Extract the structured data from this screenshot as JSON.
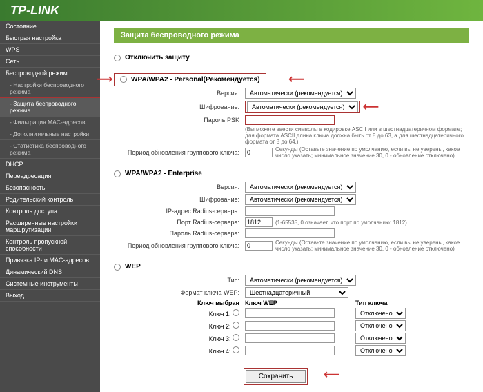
{
  "logo": "TP-LINK",
  "sidebar": {
    "items": [
      {
        "label": "Состояние"
      },
      {
        "label": "Быстрая настройка"
      },
      {
        "label": "WPS"
      },
      {
        "label": "Сеть"
      },
      {
        "label": "Беспроводной режим"
      },
      {
        "label": "- Настройки беспроводного режима",
        "sub": true
      },
      {
        "label": "- Защита беспроводного режима",
        "sub": true,
        "active": true
      },
      {
        "label": "- Фильтрация MAC-адресов",
        "sub": true
      },
      {
        "label": "- Дополнительные настройки",
        "sub": true
      },
      {
        "label": "- Статистика беспроводного режима",
        "sub": true
      },
      {
        "label": "DHCP"
      },
      {
        "label": "Переадресация"
      },
      {
        "label": "Безопасность"
      },
      {
        "label": "Родительский контроль"
      },
      {
        "label": "Контроль доступа"
      },
      {
        "label": "Расширенные настройки маршрутизации"
      },
      {
        "label": "Контроль пропускной способности"
      },
      {
        "label": "Привязка IP- и MAC-адресов"
      },
      {
        "label": "Динамический DNS"
      },
      {
        "label": "Системные инструменты"
      },
      {
        "label": "Выход"
      }
    ]
  },
  "page": {
    "title": "Защита беспроводного режима"
  },
  "sections": {
    "disable": {
      "title": "Отключить защиту"
    },
    "wpa_personal": {
      "title": "WPA/WPA2 - Personal(Рекомендуется)",
      "version_label": "Версия:",
      "version_value": "Автоматически (рекомендуется)",
      "encryption_label": "Шифрование:",
      "encryption_value": "Автоматически (рекомендуется)",
      "psk_label": "Пароль PSK",
      "psk_hint": "(Вы можете ввести символы в кодировке ASCII или в шестнадцатеричном формате; для формата ASCII длина ключа должна быть от 8 до 63, а для шестнадцатеричного формата от 8 до 64.)",
      "group_key_label": "Период обновления группового ключа:",
      "group_key_value": "0",
      "group_key_hint": "Секунды (Оставьте значение по умолчанию, если вы не уверены, какое число указать; минимальное значение 30, 0 - обновление отключено)"
    },
    "wpa_enterprise": {
      "title": "WPA/WPA2 - Enterprise",
      "version_label": "Версия:",
      "version_value": "Автоматически (рекомендуется)",
      "encryption_label": "Шифрование:",
      "encryption_value": "Автоматически (рекомендуется)",
      "radius_ip_label": "IP-адрес Radius-сервера:",
      "radius_port_label": "Порт Radius-сервера:",
      "radius_port_value": "1812",
      "radius_port_hint": "(1-65535, 0 означает, что порт по умолчанию: 1812)",
      "radius_pwd_label": "Пароль Radius-сервера:",
      "group_key_label": "Период обновления группового ключа:",
      "group_key_value": "0",
      "group_key_hint": "Секунды (Оставьте значение по умолчанию, если вы не уверены, какое число указать; минимальное значение 30, 0 - обновление отключено)"
    },
    "wep": {
      "title": "WEP",
      "type_label": "Тип:",
      "type_value": "Автоматически (рекомендуется)",
      "format_label": "Формат ключа WEP:",
      "format_value": "Шестнадцатеричный",
      "selected_label": "Ключ выбран",
      "key_col": "Ключ WEP",
      "type_col": "Тип ключа",
      "keys": [
        {
          "label": "Ключ 1:",
          "type": "Отключено"
        },
        {
          "label": "Ключ 2:",
          "type": "Отключено"
        },
        {
          "label": "Ключ 3:",
          "type": "Отключено"
        },
        {
          "label": "Ключ 4:",
          "type": "Отключено"
        }
      ]
    }
  },
  "buttons": {
    "save": "Сохранить"
  }
}
